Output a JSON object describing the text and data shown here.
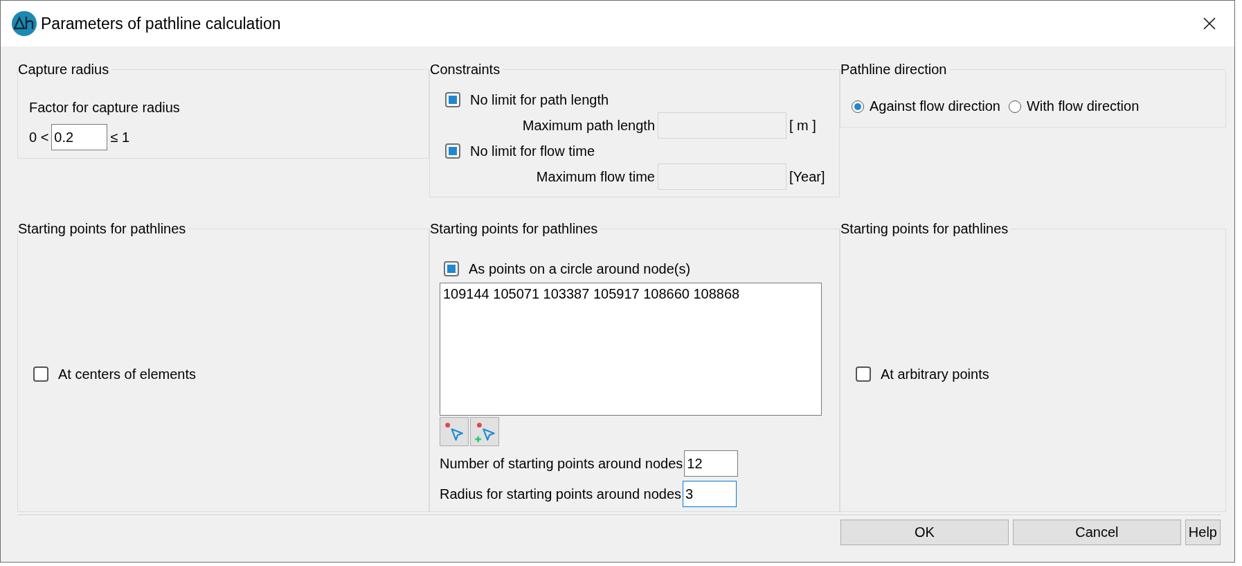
{
  "window": {
    "title": "Parameters of pathline calculation"
  },
  "capture_radius": {
    "title": "Capture radius",
    "label": "Factor for capture radius",
    "prefix": "0 <",
    "value": "0.2",
    "suffix": "≤ 1"
  },
  "constraints": {
    "title": "Constraints",
    "items": [
      {
        "label": "No limit for path length",
        "checked": true,
        "field_label": "Maximum path length",
        "field_disabled": true,
        "unit": "[ m ]"
      },
      {
        "label": "No limit for flow time",
        "checked": true,
        "field_label": "Maximum flow time",
        "field_disabled": true,
        "unit": "[Year]"
      }
    ]
  },
  "pathline_direction": {
    "title": "Pathline direction",
    "options": [
      {
        "label": "Against flow direction",
        "selected": true
      },
      {
        "label": "With flow direction",
        "selected": false
      }
    ]
  },
  "starting_points": [
    {
      "kind": "checkbox",
      "title": "Starting points for pathlines",
      "label": "At centers of elements",
      "checked": false
    },
    {
      "kind": "nodes",
      "title": "Starting points for pathlines",
      "label": "As points on a circle around node(s)",
      "checked": true,
      "nodes": "109144 105071 103387 105917 108660 108868",
      "fields": [
        {
          "label": "Number of starting points around nodes",
          "value": "12",
          "focused": false
        },
        {
          "label": "Radius for starting points around nodes",
          "value": "3",
          "focused": true
        }
      ]
    },
    {
      "kind": "checkbox",
      "title": "Starting points for pathlines",
      "label": "At arbitrary points",
      "checked": false
    }
  ],
  "buttons": [
    {
      "label": "OK"
    },
    {
      "label": "Cancel"
    },
    {
      "label": "Help"
    }
  ]
}
